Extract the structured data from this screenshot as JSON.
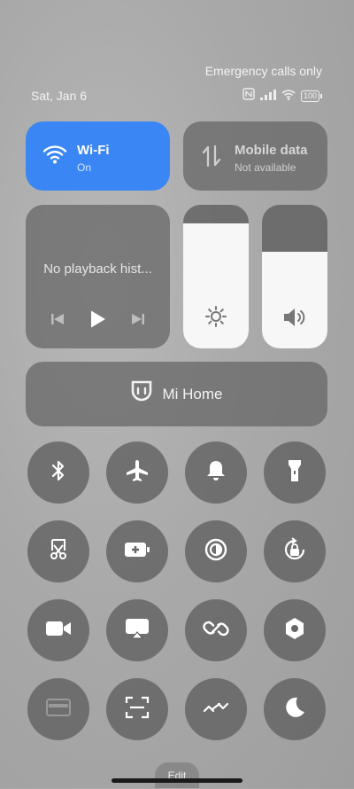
{
  "status": {
    "carrier_text": "Emergency calls only",
    "date": "Sat, Jan 6",
    "nfc_icon": "nfc-icon",
    "signal_icon": "signal-bars-icon",
    "wifi_icon": "wifi-status-icon",
    "battery": "100"
  },
  "tiles": {
    "wifi": {
      "label": "Wi-Fi",
      "state": "On",
      "icon": "wifi-icon",
      "color": "#3a86f4"
    },
    "mobile": {
      "label": "Mobile data",
      "state": "Not available",
      "icon": "mobile-data-icon"
    }
  },
  "media": {
    "text": "No playback hist...",
    "controls": [
      "previous-track-icon",
      "play-icon",
      "next-track-icon"
    ]
  },
  "sliders": {
    "brightness": {
      "icon": "sun-icon",
      "level": 0.87
    },
    "volume": {
      "icon": "speaker-icon",
      "level": 0.67
    }
  },
  "mihome": {
    "label": "Mi Home",
    "icon": "mi-home-icon"
  },
  "toggles": [
    [
      "bluetooth-icon",
      "airplane-icon",
      "bell-icon",
      "flashlight-icon"
    ],
    [
      "screenshot-icon",
      "battery-saver-icon",
      "reading-mode-icon",
      "rotation-lock-icon"
    ],
    [
      "video-camera-icon",
      "cast-icon",
      "link-icon",
      "settings-hex-icon"
    ],
    [
      "card-icon",
      "scanner-icon",
      "nearby-share-icon",
      "dark-mode-icon"
    ]
  ],
  "edit_label": "Edit"
}
